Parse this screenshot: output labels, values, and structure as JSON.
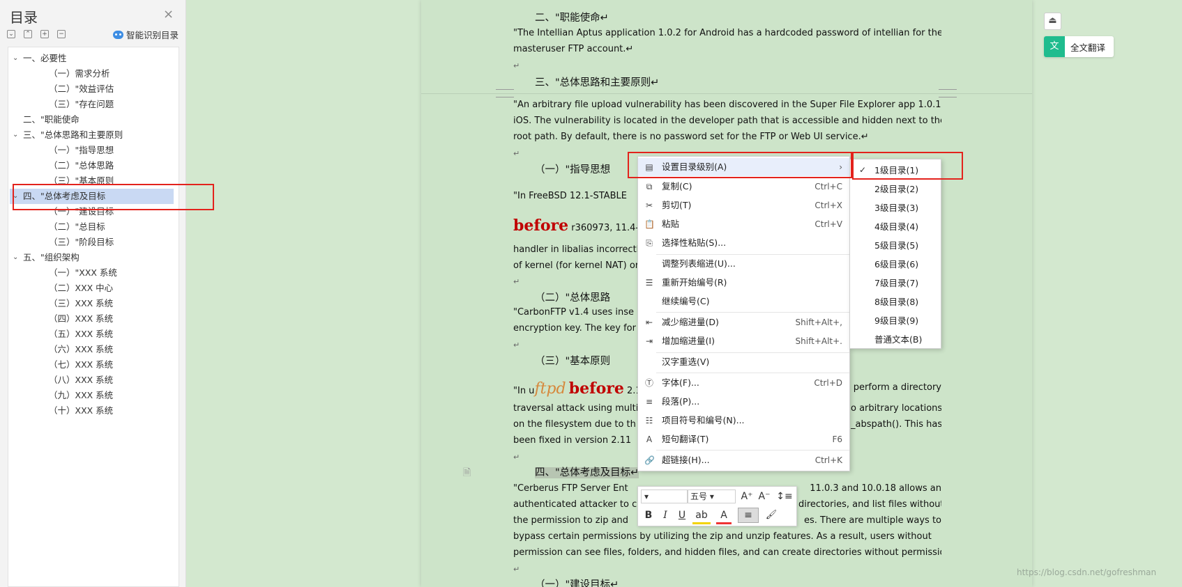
{
  "toc": {
    "title": "目录",
    "close": "×",
    "smart_label": "智能识别目录",
    "tools": [
      "⌄",
      "⌃",
      "+",
      "−"
    ],
    "items": [
      {
        "text": "一、必要性",
        "arrow": "⌄"
      },
      {
        "text": "（一）需求分析"
      },
      {
        "text": "（二）\"效益评估"
      },
      {
        "text": "（三）\"存在问题"
      },
      {
        "text": "二、\"职能使命"
      },
      {
        "text": "三、\"总体思路和主要原则",
        "arrow": "⌄"
      },
      {
        "text": "（一）\"指导思想"
      },
      {
        "text": "（二）\"总体思路"
      },
      {
        "text": "（三）\"基本原则"
      },
      {
        "text": "四、\"总体考虑及目标",
        "arrow": "⌄"
      },
      {
        "text": "（一）\"建设目标"
      },
      {
        "text": "（二）\"总目标"
      },
      {
        "text": "（三）\"阶段目标"
      },
      {
        "text": "五、\"组织架构",
        "arrow": "⌄"
      },
      {
        "text": "（一）\"XXX 系统"
      },
      {
        "text": "（二）XXX 中心"
      },
      {
        "text": "（三）XXX 系统"
      },
      {
        "text": "（四）XXX 系统"
      },
      {
        "text": "（五）XXX 系统"
      },
      {
        "text": "（六）XXX 系统"
      },
      {
        "text": "（七）XXX 系统"
      },
      {
        "text": "（八）XXX 系统"
      },
      {
        "text": "（九）XXX 系统"
      },
      {
        "text": "（十）XXX 系统"
      }
    ]
  },
  "doc": {
    "h_mission": "二、\"职能使命↵",
    "p1_a": "\"The Intellian Aptus application 1.0.2 for Android has a hardcoded password of intellian for the",
    "p1_b": "masteruser FTP account.↵",
    "mark": "↵",
    "h_principles": "三、\"总体思路和主要原则↵",
    "p2_a": "\"An arbitrary file upload vulnerability has been discovered in the Super File Explorer app 1.0.1 for",
    "p2_b": "iOS. The vulnerability is located in the developer path that is accessible and hidden next to the",
    "p2_c": "root path. By default, there is no password set for the FTP or Web UI service.↵",
    "h_guide": "（一）\"指导思想",
    "p3_a": "\"In FreeBSD 12.1-STABLE",
    "p3_before": "before",
    "p3_b": " r360973, 11.4-B",
    "p3_c": "handler in libalias incorrectly",
    "p3_d": "of kernel (for kernel NAT) or",
    "h_overall": "（二）\"总体思路",
    "p4_a": "\"CarbonFTP v1.4 uses inse",
    "p4_b": "encryption key. The key for lo",
    "h_basic": "（三）\"基本原则",
    "p5_pre": "\"In u",
    "p5_ftpd": "ftpd",
    "p5_before": "before",
    "p5_mid": " 2.1",
    "p5_tail": "perform a directory",
    "p5_b": "traversal attack using multip",
    "p5_b_tail": "o arbitrary locations",
    "p5_c": "on the filesystem due to th",
    "p5_c_tail": "_abspath(). This has",
    "p5_d": "been fixed in version 2.11",
    "h_goal": "四、\"总体考虑及目标↵",
    "p6_a": "\"Cerberus FTP Server Ent",
    "p6_a_tail": "11.0.3 and 10.0.18 allows an",
    "p6_b": "authenticated attacker to cr",
    "p6_b_tail": "directories, and list files without",
    "p6_c": "the permission to zip and",
    "p6_c_tail": "es. There are multiple ways to",
    "p6_d": "bypass certain permissions by utilizing the zip and unzip features. As a result, users without",
    "p6_e": "permission can see files, folders, and hidden files, and can create directories without permission.↵",
    "h_build": "（一）\"建设目标↵"
  },
  "menu": {
    "items": [
      {
        "label": "设置目录级别(A)",
        "shortcut": "›",
        "icon": "toc-level-icon",
        "glyph": "▤"
      },
      {
        "label": "复制(C)",
        "shortcut": "Ctrl+C",
        "icon": "copy-icon",
        "glyph": "⧉"
      },
      {
        "label": "剪切(T)",
        "shortcut": "Ctrl+X",
        "icon": "cut-icon",
        "glyph": "✂"
      },
      {
        "label": "粘贴",
        "shortcut": "Ctrl+V",
        "icon": "paste-icon",
        "glyph": "📋"
      },
      {
        "label": "选择性粘贴(S)...",
        "shortcut": "",
        "icon": "paste-special-icon",
        "glyph": "⎘"
      },
      {
        "label": "调整列表缩进(U)...",
        "shortcut": "",
        "icon": "",
        "glyph": ""
      },
      {
        "label": "重新开始编号(R)",
        "shortcut": "",
        "icon": "restart-numbering-icon",
        "glyph": "☰"
      },
      {
        "label": "继续编号(C)",
        "shortcut": "",
        "icon": "",
        "glyph": ""
      },
      {
        "label": "减少缩进量(D)",
        "shortcut": "Shift+Alt+,",
        "icon": "decrease-indent-icon",
        "glyph": "⇤"
      },
      {
        "label": "增加缩进量(I)",
        "shortcut": "Shift+Alt+.",
        "icon": "increase-indent-icon",
        "glyph": "⇥"
      },
      {
        "label": "汉字重选(V)",
        "shortcut": "",
        "icon": "",
        "glyph": ""
      },
      {
        "label": "字体(F)...",
        "shortcut": "Ctrl+D",
        "icon": "font-icon",
        "glyph": "Ⓣ"
      },
      {
        "label": "段落(P)...",
        "shortcut": "",
        "icon": "paragraph-icon",
        "glyph": "≡"
      },
      {
        "label": "项目符号和编号(N)...",
        "shortcut": "",
        "icon": "bullets-icon",
        "glyph": "☷"
      },
      {
        "label": "短句翻译(T)",
        "shortcut": "F6",
        "icon": "translate-icon",
        "glyph": "A"
      },
      {
        "label": "超链接(H)...",
        "shortcut": "Ctrl+K",
        "icon": "hyperlink-icon",
        "glyph": "🔗"
      }
    ]
  },
  "submenu": {
    "check": "✓",
    "items": [
      "1级目录(1)",
      "2级目录(2)",
      "3级目录(3)",
      "4级目录(4)",
      "5级目录(5)",
      "6级目录(6)",
      "7级目录(7)",
      "8级目录(8)",
      "9级目录(9)",
      "普通文本(B)"
    ]
  },
  "mini_toolbar": {
    "font_size": "五号",
    "grow": "A⁺",
    "shrink": "A⁻",
    "spacing": "↕≡",
    "bold": "B",
    "italic": "I",
    "underline": "U",
    "highlight": "ab",
    "color": "A",
    "align": "≡",
    "format_painter": "🖌"
  },
  "right": {
    "collapse": "⏏",
    "translate_icon": "文",
    "translate_label": "全文翻译"
  },
  "watermark": "https://blog.csdn.net/gofreshman",
  "doc_marker": "🗎"
}
